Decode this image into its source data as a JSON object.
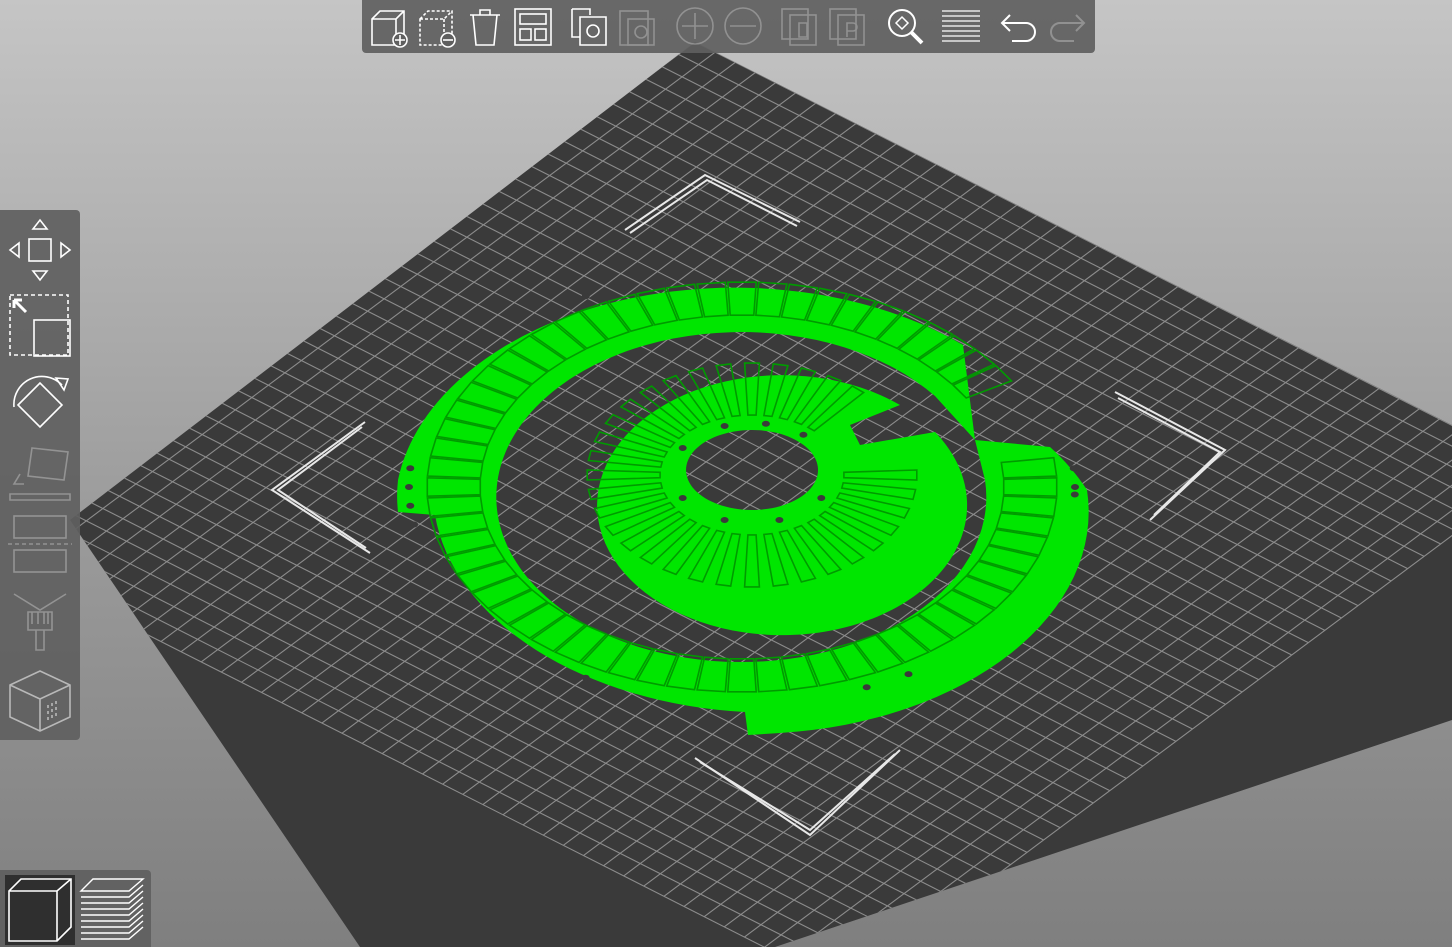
{
  "app": {
    "window_title": "",
    "view": "3D"
  },
  "colors": {
    "background_top": "#c5c5c5",
    "background_bottom": "#7f7f7f",
    "bed": "#3a3a3a",
    "bed_grid": "#8c8c8c",
    "model": "#00e600",
    "model_detail": "#009b00",
    "toolbar": "#5f5f5f",
    "icon": "#ffffff"
  },
  "top_toolbar": {
    "items": [
      {
        "name": "add-object-icon",
        "enabled": true
      },
      {
        "name": "delete-object-icon",
        "enabled": true
      },
      {
        "name": "delete-all-icon",
        "enabled": true
      },
      {
        "name": "arrange-icon",
        "enabled": true
      },
      {
        "name": "copy-icon",
        "enabled": true
      },
      {
        "name": "paste-icon",
        "enabled": false
      },
      {
        "name": "add-instance-icon",
        "enabled": false
      },
      {
        "name": "remove-instance-icon",
        "enabled": false
      },
      {
        "name": "split-to-objects-icon",
        "enabled": false
      },
      {
        "name": "split-to-parts-icon",
        "enabled": false
      },
      {
        "name": "search-icon",
        "enabled": true
      },
      {
        "name": "layers-editing-icon",
        "enabled": true
      },
      {
        "name": "undo-icon",
        "enabled": true
      },
      {
        "name": "redo-icon",
        "enabled": false
      }
    ]
  },
  "left_toolbar": {
    "items": [
      {
        "name": "move-icon",
        "enabled": true
      },
      {
        "name": "scale-icon",
        "enabled": true
      },
      {
        "name": "rotate-icon",
        "enabled": true
      },
      {
        "name": "place-on-face-icon",
        "enabled": false
      },
      {
        "name": "cut-icon",
        "enabled": false
      },
      {
        "name": "paint-supports-icon",
        "enabled": false
      },
      {
        "name": "seam-painting-icon",
        "enabled": false
      }
    ]
  },
  "view_switch": {
    "items": [
      {
        "name": "view-3d-icon",
        "active": true
      },
      {
        "name": "preview-layers-icon",
        "active": false
      }
    ]
  }
}
